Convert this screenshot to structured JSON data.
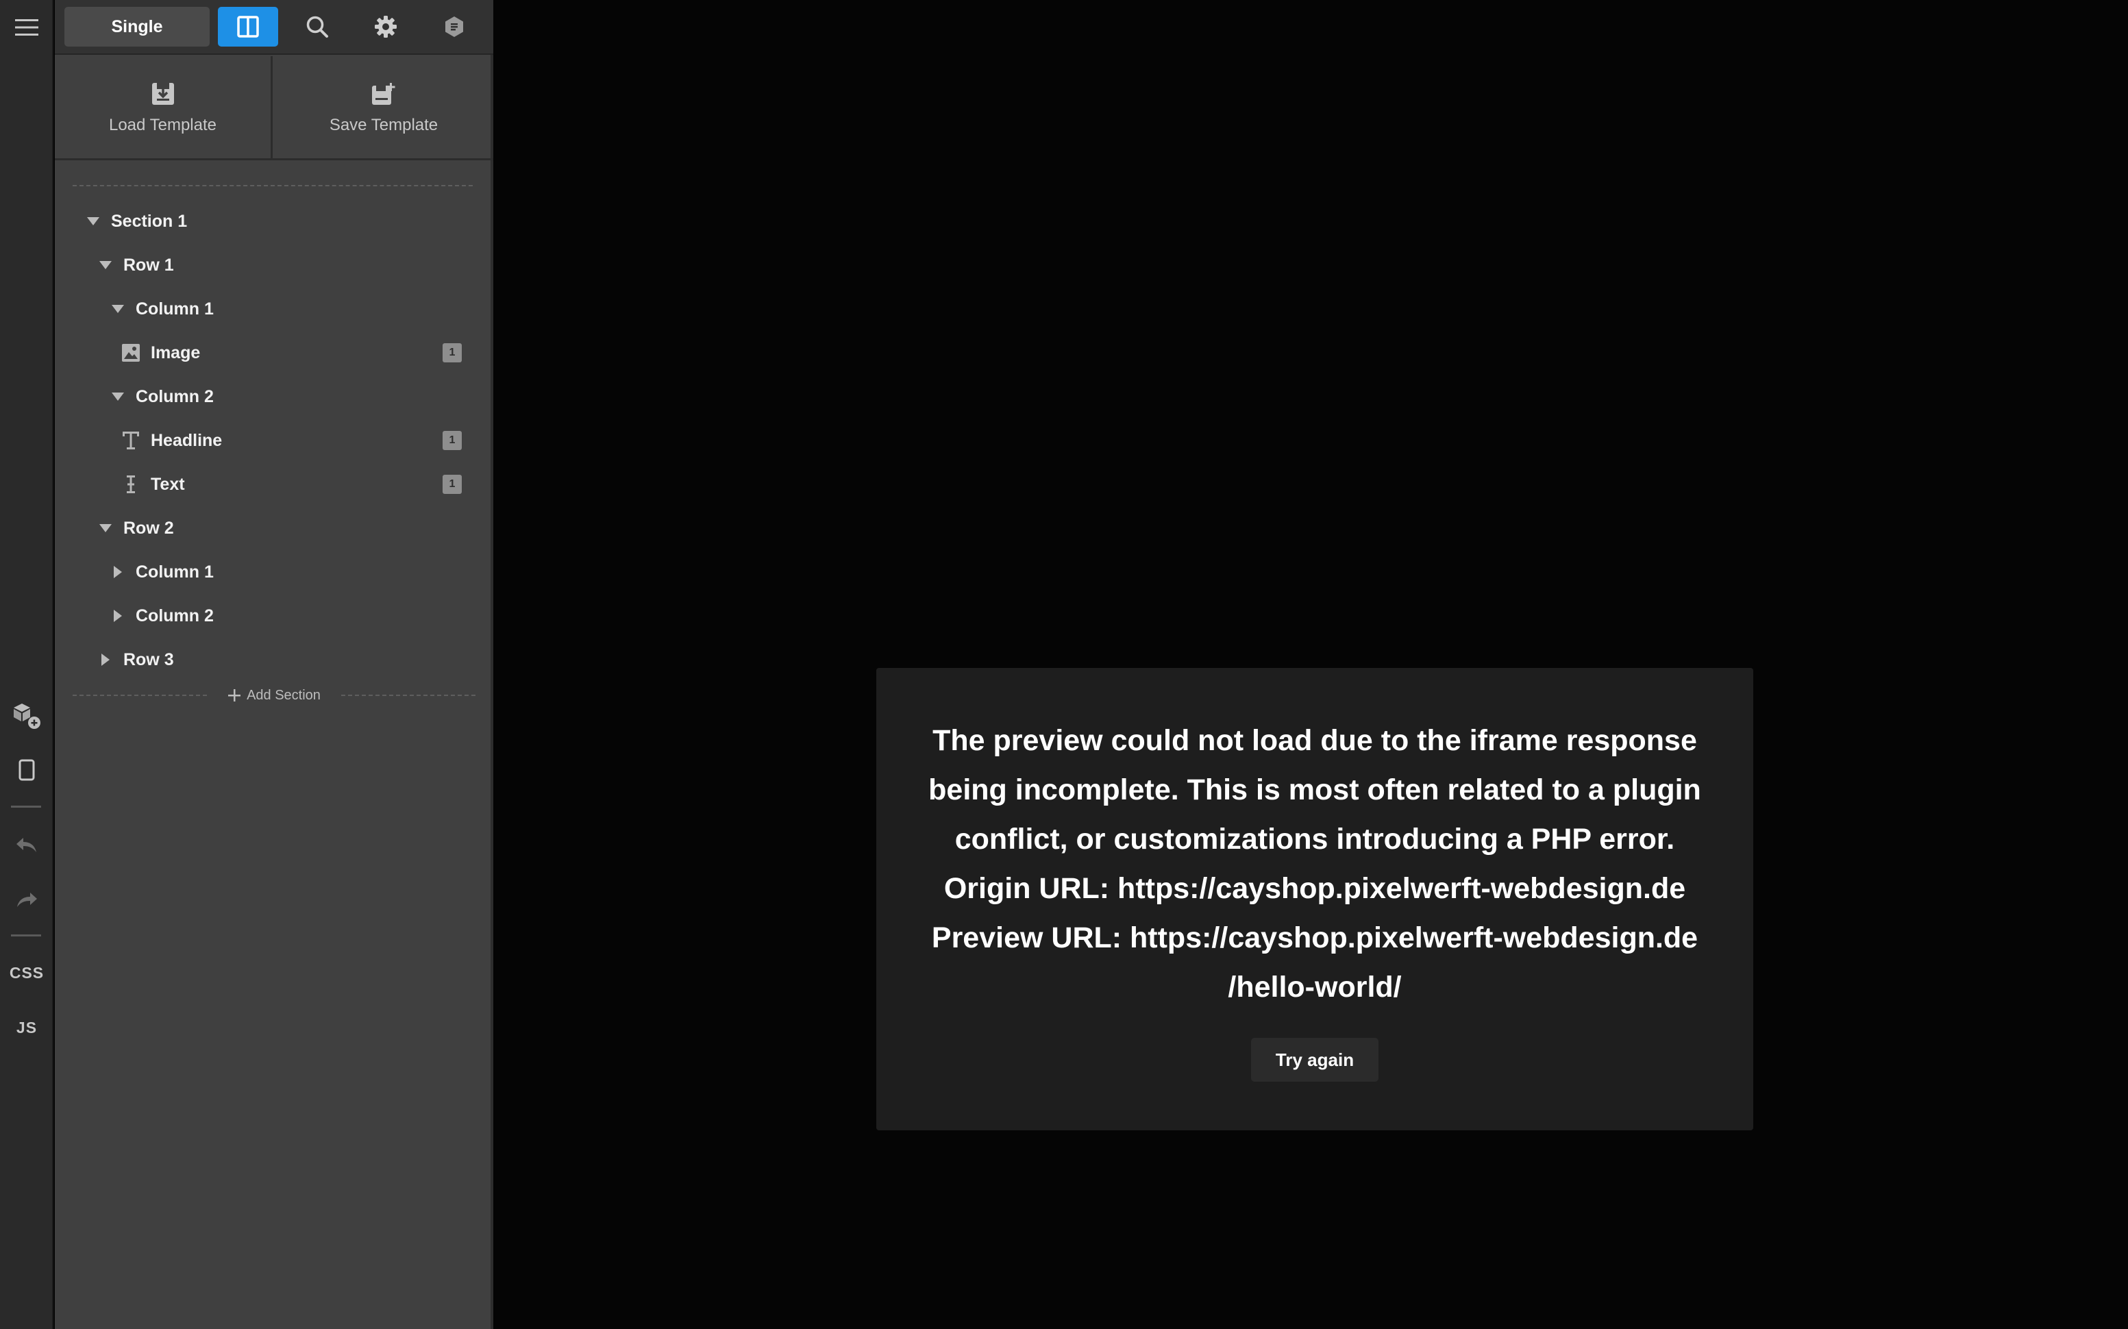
{
  "toolbar": {
    "mode_label": "Single",
    "icons": [
      "hamburger-icon",
      "layout-columns-icon",
      "search-icon",
      "gear-icon",
      "hexagon-icon"
    ],
    "accent_color": "#1e90e6"
  },
  "templates": {
    "load_label": "Load Template",
    "save_label": "Save Template"
  },
  "tree": {
    "items": [
      {
        "label": "Section 1",
        "state": "expanded"
      },
      {
        "label": "Row 1",
        "state": "expanded"
      },
      {
        "label": "Column 1",
        "state": "expanded"
      },
      {
        "label": "Image",
        "icon": "image-icon",
        "badge": "1"
      },
      {
        "label": "Column 2",
        "state": "expanded"
      },
      {
        "label": "Headline",
        "icon": "headline-icon",
        "badge": "1"
      },
      {
        "label": "Text",
        "icon": "text-cursor-icon",
        "badge": "1"
      },
      {
        "label": "Row 2",
        "state": "expanded"
      },
      {
        "label": "Column 1",
        "state": "collapsed"
      },
      {
        "label": "Column 2",
        "state": "collapsed"
      },
      {
        "label": "Row 3",
        "state": "collapsed"
      }
    ],
    "add_section_label": "Add Section"
  },
  "rail": {
    "css_label": "CSS",
    "js_label": "JS"
  },
  "dialog": {
    "lines": [
      "The preview could not load due to the iframe response",
      "being incomplete. This is most often related to a plugin",
      "conflict, or customizations introducing a PHP error.",
      "Origin URL: https://cayshop.pixelwerft-webdesign.de",
      "Preview URL: https://cayshop.pixelwerft-webdesign.de",
      "/hello-world/"
    ],
    "retry_label": "Try again"
  }
}
